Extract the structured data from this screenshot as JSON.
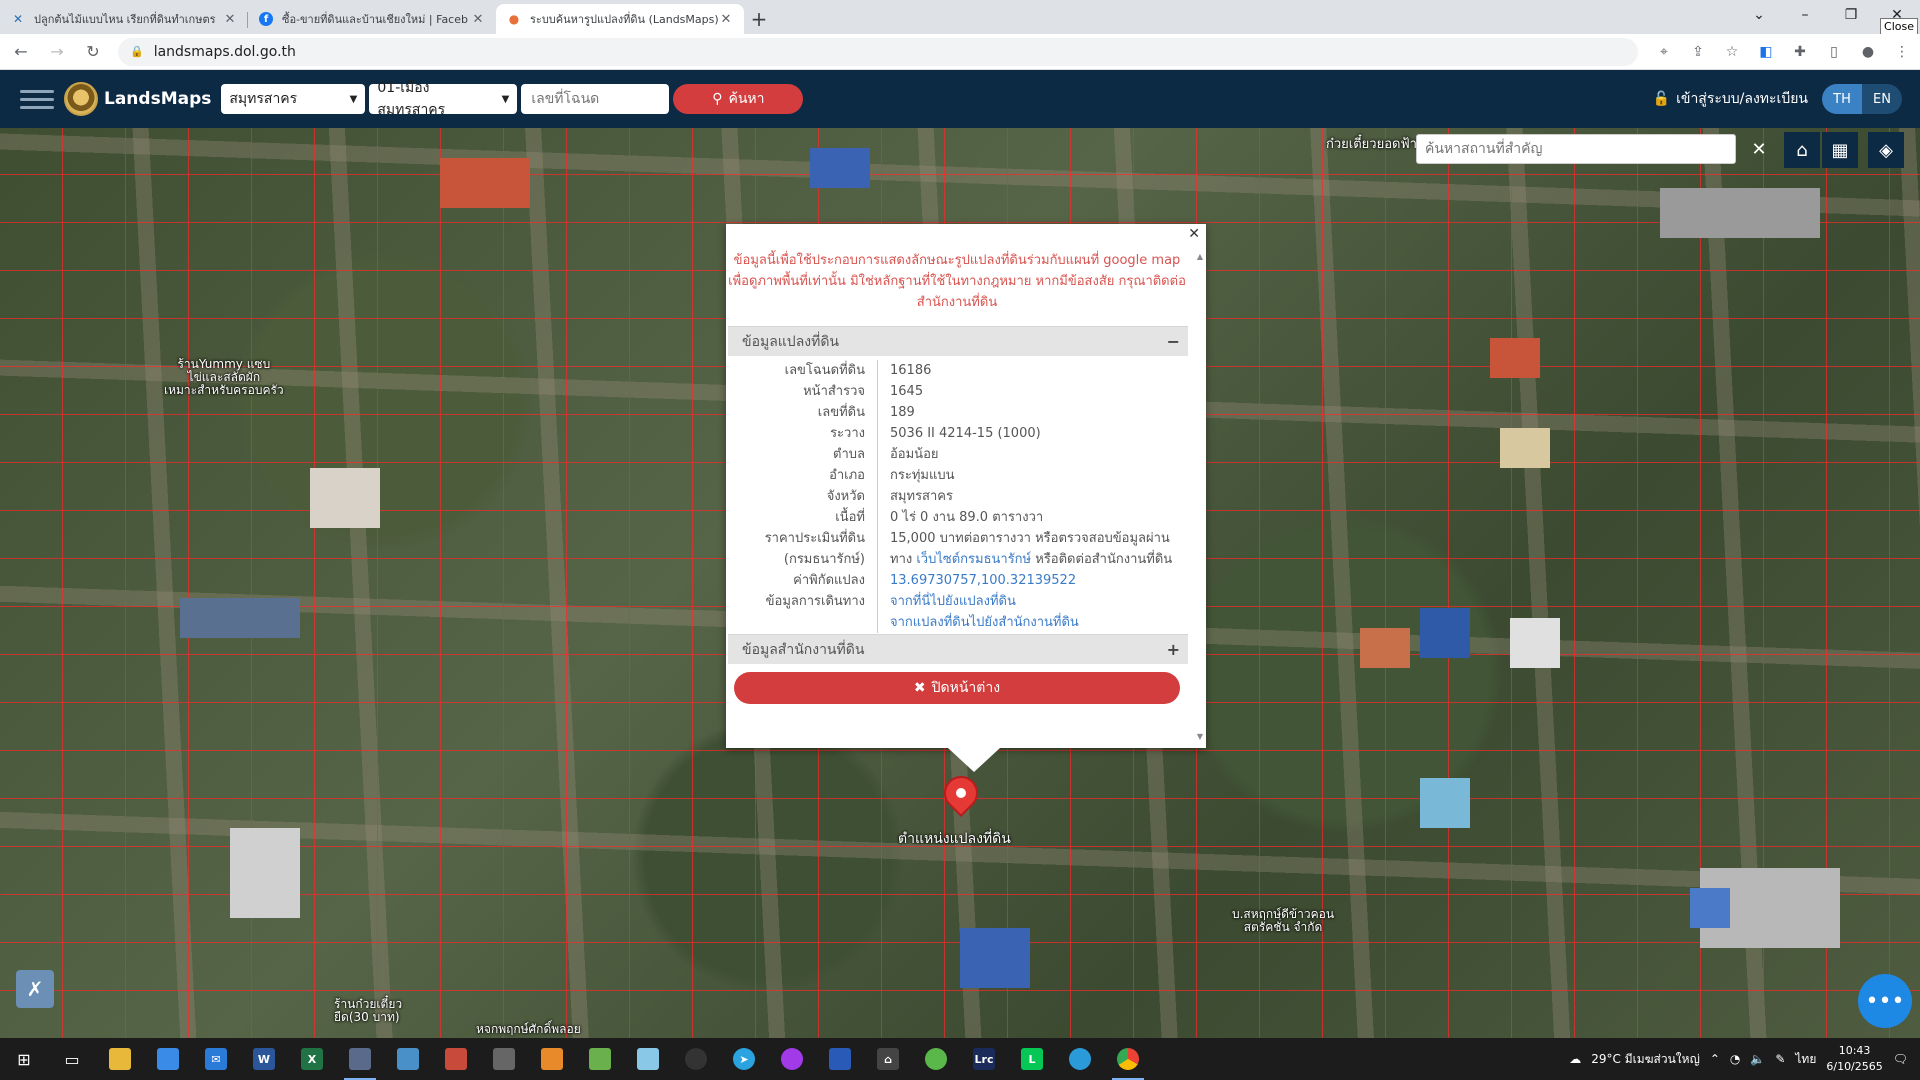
{
  "browser": {
    "tabs": [
      {
        "title": "ปลูกต้นไม้แบบไหน เรียกที่ดินทำเกษตร",
        "icon": "agri-icon",
        "active": false
      },
      {
        "title": "ซื้อ-ขายที่ดินและบ้านเชียงใหม่ | Faceb",
        "icon": "facebook-icon",
        "active": false
      },
      {
        "title": "ระบบค้นหารูปแปลงที่ดิน (LandsMaps)",
        "icon": "map-pin-icon",
        "active": true
      }
    ],
    "url": "landsmaps.dol.go.th",
    "close_tooltip": "Close"
  },
  "header": {
    "brand": "LandsMaps",
    "province_select": "สมุทรสาคร",
    "district_select": "01-เมืองสมุทรสาคร",
    "deed_input_placeholder": "เลขที่โฉนด",
    "search_label": "ค้นหา",
    "login_label": "เข้าสู่ระบบ/ลงทะเบียน",
    "lang_th": "TH",
    "lang_en": "EN"
  },
  "map": {
    "place_search_placeholder": "ค้นหาสถานที่สำคัญ",
    "pois": [
      {
        "label": "ก๋วยเตี๋ยวยอดฟ้าเรือ"
      },
      {
        "label": "ร้านYummy แซบ\nไข่และสลัดผัก\nเหมาะสำหรับครอบครัว"
      },
      {
        "label": "บ.สหฤกษ์ดีข้าวคอน\nสตรัคชั่น จำกัด"
      },
      {
        "label": "ร้านก๋วยเตี๋ยว\nยืด(30 บาท)"
      },
      {
        "label": "หจกพฤกษ์ศักดิ์พลอย"
      }
    ],
    "marker_label": "ตำแหน่งแปลงที่ดิน"
  },
  "popup": {
    "disclaimer": "ข้อมูลนี้เพื่อใช้ประกอบการแสดงลักษณะรูปแปลงที่ดินร่วมกับแผนที่ google map เพื่อดูภาพพื้นที่เท่านั้น มิใช่หลักฐานที่ใช้ในทางกฎหมาย หากมีข้อสงสัย กรุณาติดต่อสำนักงานที่ดิน",
    "section_parcel": "ข้อมูลแปลงที่ดิน",
    "section_parcel_toggle": "−",
    "section_office": "ข้อมูลสำนักงานที่ดิน",
    "section_office_toggle": "+",
    "rows": [
      {
        "key": "เลขโฉนดที่ดิน",
        "value": "16186"
      },
      {
        "key": "หน้าสำรวจ",
        "value": "1645"
      },
      {
        "key": "เลขที่ดิน",
        "value": "189"
      },
      {
        "key": "ระวาง",
        "value": "5036 II 4214-15 (1000)"
      },
      {
        "key": "ตำบล",
        "value": "อ้อมน้อย"
      },
      {
        "key": "อำเภอ",
        "value": "กระทุ่มแบน"
      },
      {
        "key": "จังหวัด",
        "value": "สมุทรสาคร"
      },
      {
        "key": "เนื้อที่",
        "value": "0 ไร่ 0 งาน 89.0 ตารางวา"
      },
      {
        "key": "ราคาประเมินที่ดิน",
        "value": "15,000 บาทต่อตารางวา หรือตรวจสอบข้อมูลผ่าน"
      },
      {
        "key": "(กรมธนารักษ์)",
        "value_prefix": "ทาง ",
        "value_link": "เว็บไซต์กรมธนารักษ์",
        "value_suffix": " หรือติดต่อสำนักงานที่ดิน"
      },
      {
        "key": "ค่าพิกัดแปลง",
        "value_link": "13.69730757,100.32139522"
      },
      {
        "key": "ข้อมูลการเดินทาง",
        "value_link": "จากที่นี่ไปยังแปลงที่ดิน"
      },
      {
        "key": "",
        "value_link": "จากแปลงที่ดินไปยังสำนักงานที่ดิน"
      }
    ],
    "close_label": "ปิดหน้าต่าง"
  },
  "taskbar": {
    "weather": "29°C มีเมฆส่วนใหญ่",
    "lang": "ไทย",
    "time": "10:43",
    "date": "6/10/2565"
  },
  "colors": {
    "header_bg": "#0d2a45",
    "accent_red": "#d33d3d",
    "lang_active": "#3b82c4",
    "link_blue": "#3a7bc8",
    "parcel_line": "#ff2828"
  }
}
